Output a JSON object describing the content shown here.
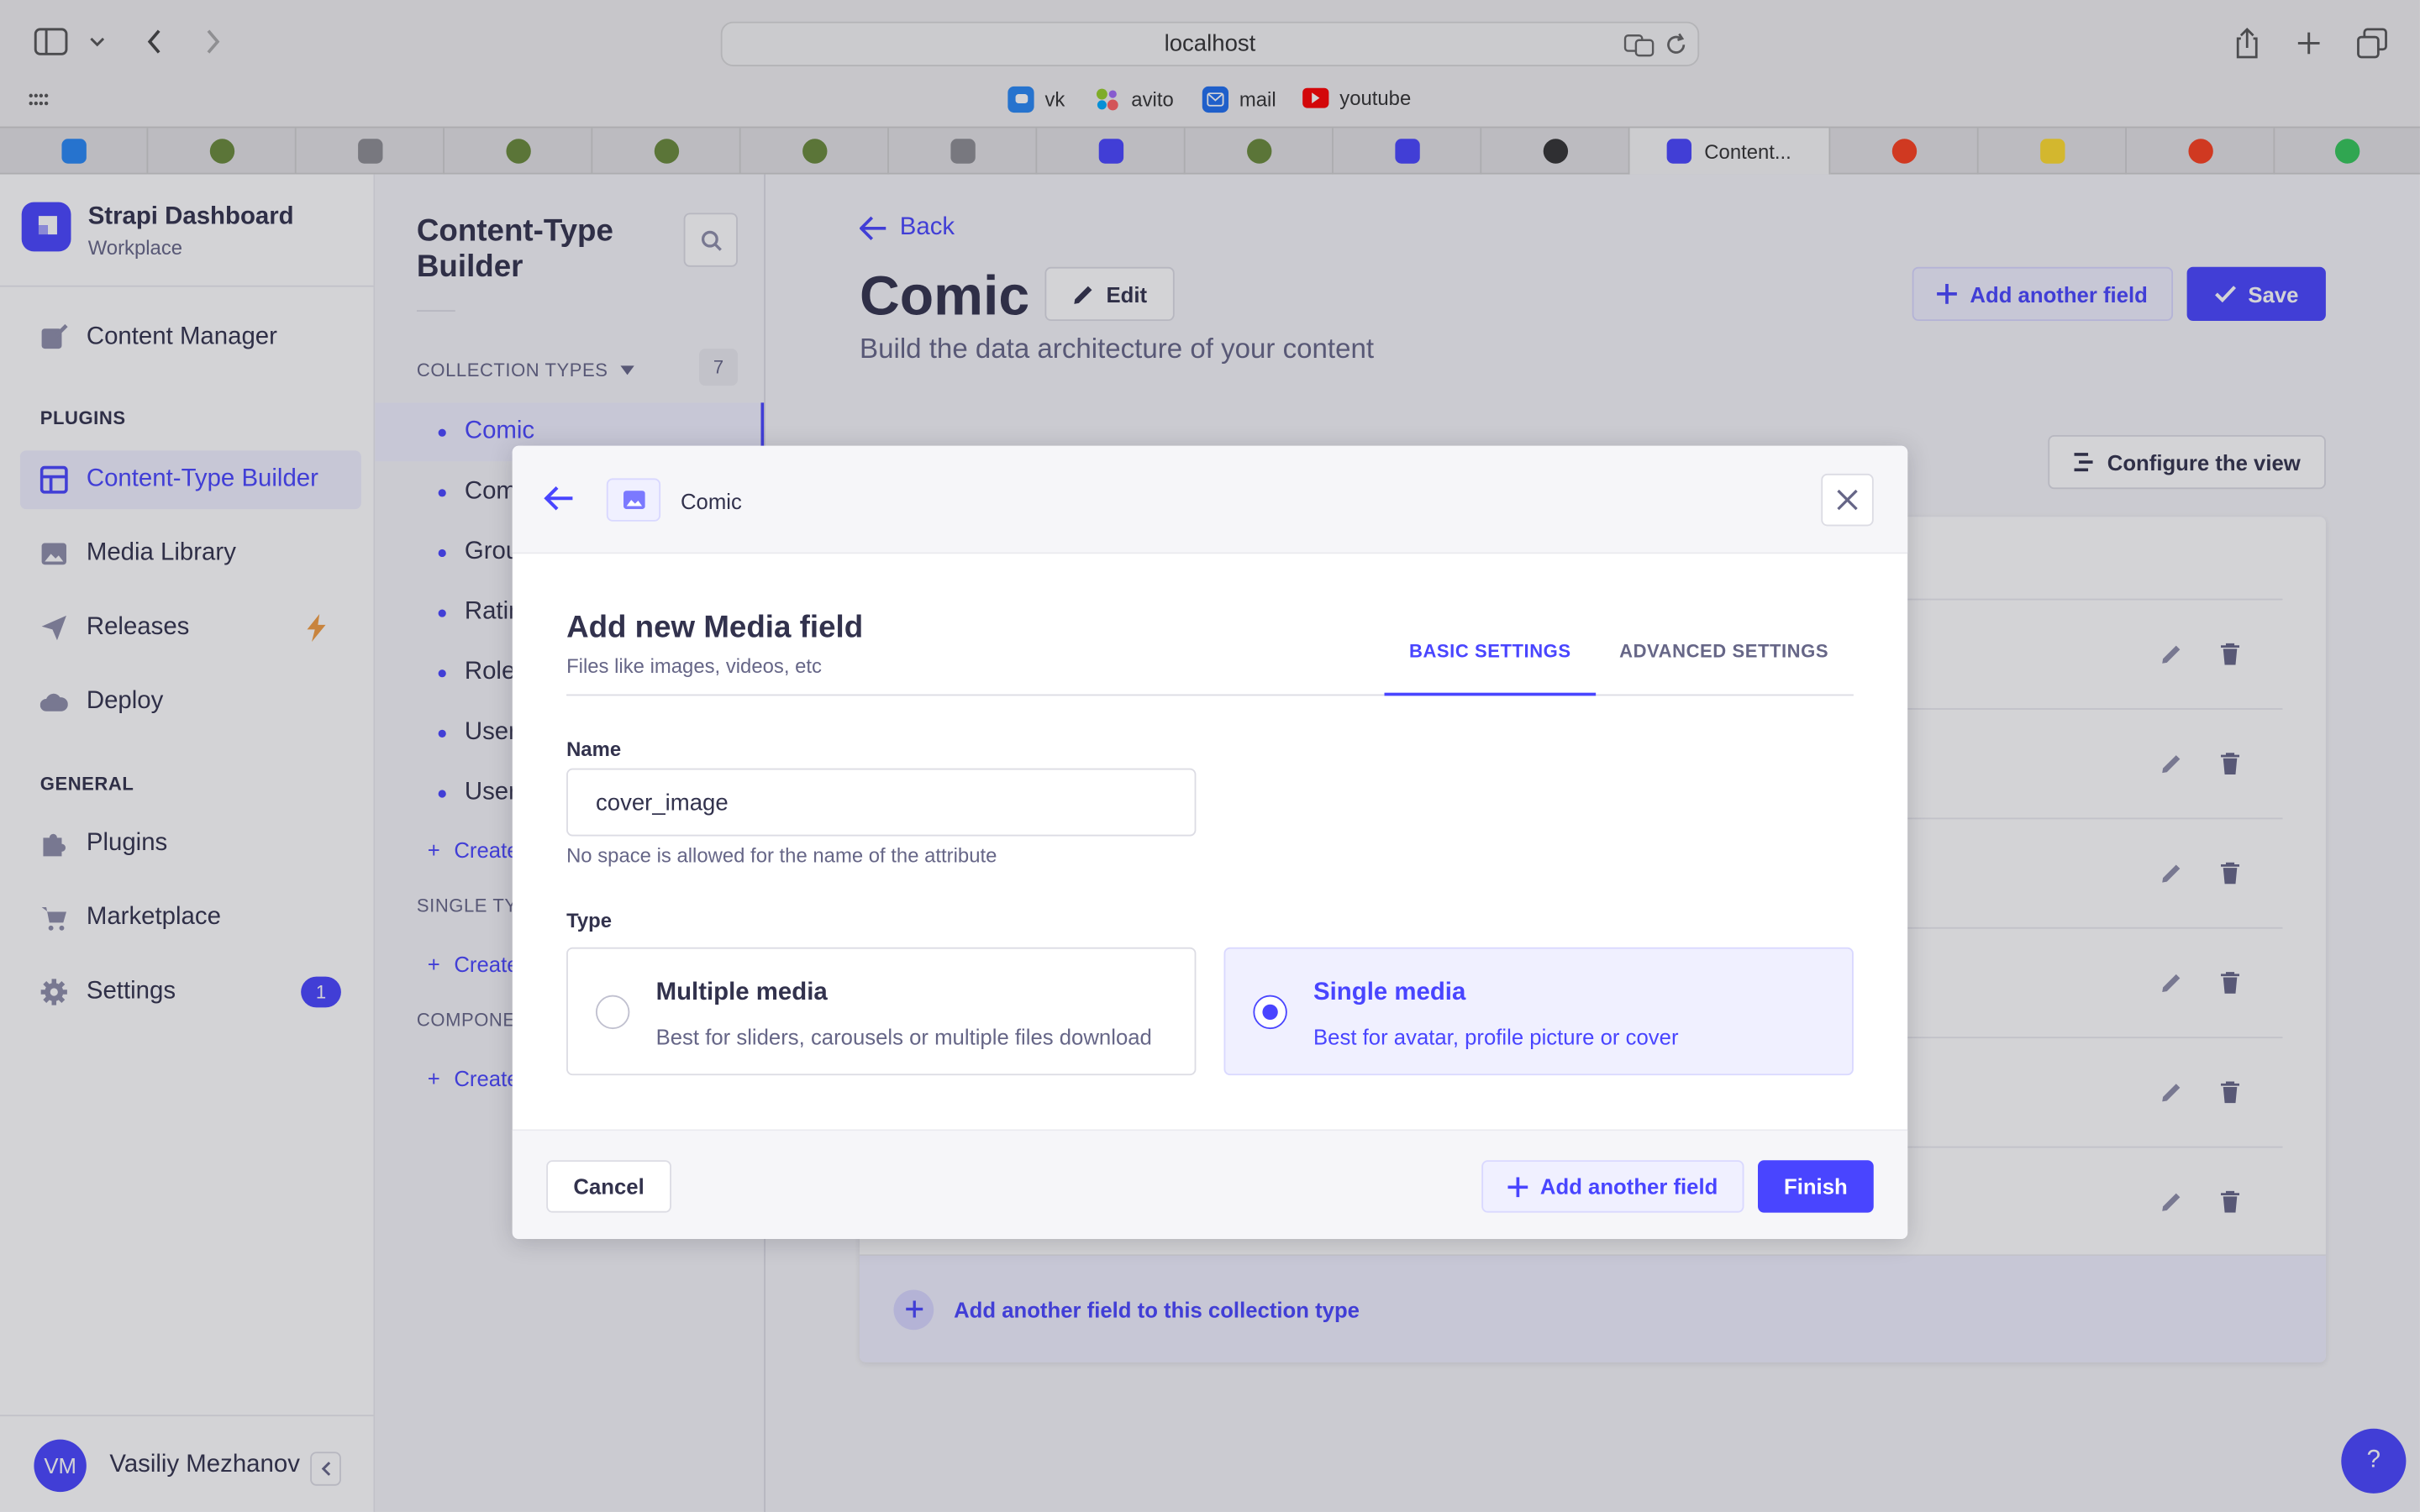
{
  "browser": {
    "url": "localhost",
    "bookmarks": [
      {
        "label": "vk",
        "icon": "vk-chat-icon"
      },
      {
        "label": "avito",
        "icon": "avito-icon"
      },
      {
        "label": "mail",
        "icon": "mail-icon"
      },
      {
        "label": "youtube",
        "icon": "youtube-icon"
      }
    ],
    "active_tab_title": "Content..."
  },
  "sidebar": {
    "app_title": "Strapi Dashboard",
    "app_subtitle": "Workplace",
    "content_manager": "Content Manager",
    "plugins_header": "PLUGINS",
    "plugins": [
      {
        "label": "Content-Type Builder",
        "icon": "layout-icon",
        "active": true
      },
      {
        "label": "Media Library",
        "icon": "image-icon"
      },
      {
        "label": "Releases",
        "icon": "paper-plane-icon"
      },
      {
        "label": "Deploy",
        "icon": "cloud-icon"
      }
    ],
    "general_header": "GENERAL",
    "general": [
      {
        "label": "Plugins",
        "icon": "puzzle-icon"
      },
      {
        "label": "Marketplace",
        "icon": "cart-icon"
      },
      {
        "label": "Settings",
        "icon": "gear-icon",
        "badge": "1"
      }
    ],
    "user_initials": "VM",
    "user_name": "Vasiliy Mezhanov"
  },
  "subnav": {
    "title_line1": "Content-Type",
    "title_line2": "Builder",
    "collection_header": "COLLECTION TYPES",
    "collection_count": "7",
    "collections": [
      "Comic",
      "Com",
      "Grou",
      "Ratin",
      "Role",
      "User",
      "User"
    ],
    "create_label": "Create",
    "single_header": "SINGLE TY",
    "components_header": "COMPONE"
  },
  "main": {
    "back": "Back",
    "title": "Comic",
    "edit": "Edit",
    "subtitle": "Build the data architecture of your content",
    "add_another_field": "Add another field",
    "save": "Save",
    "configure_view": "Configure the view",
    "add_field_to_collection": "Add another field to this collection type"
  },
  "modal": {
    "breadcrumb": "Comic",
    "title": "Add new Media field",
    "subtitle": "Files like images, videos, etc",
    "tabs": [
      "BASIC SETTINGS",
      "ADVANCED SETTINGS"
    ],
    "name_label": "Name",
    "name_value": "cover_image",
    "name_hint": "No space is allowed for the name of the attribute",
    "type_label": "Type",
    "options": [
      {
        "title": "Multiple media",
        "desc": "Best for sliders, carousels or multiple files download",
        "selected": false
      },
      {
        "title": "Single media",
        "desc": "Best for avatar, profile picture or cover",
        "selected": true
      }
    ],
    "cancel": "Cancel",
    "add_another_field": "Add another field",
    "finish": "Finish"
  },
  "help": "?",
  "colors": {
    "primary": "#4945ff",
    "primary_light": "#f0f0ff",
    "text": "#32324d",
    "muted": "#666687"
  }
}
